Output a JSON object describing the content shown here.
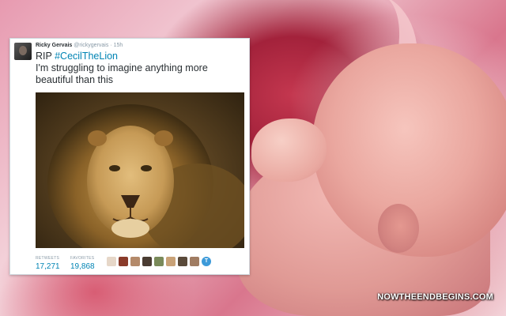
{
  "tweet": {
    "display_name": "Ricky Gervais",
    "handle": "@rickygervais",
    "time": "15h",
    "text_prefix": "RIP ",
    "hashtag": "#CecilTheLion",
    "text_body": "I'm struggling to imagine anything more beautiful than this",
    "photo_icon": "lion-photo",
    "retweets_label": "RETWEETS",
    "retweets_count": "17,271",
    "favorites_label": "FAVORITES",
    "favorites_count": "19,868",
    "favorited_by_more_icon": "twitter-t-badge"
  },
  "watermark": "NOWTHEENDBEGINS.COM",
  "colors": {
    "link": "#0084b4",
    "text": "#292f33",
    "meta": "#8899a6"
  }
}
